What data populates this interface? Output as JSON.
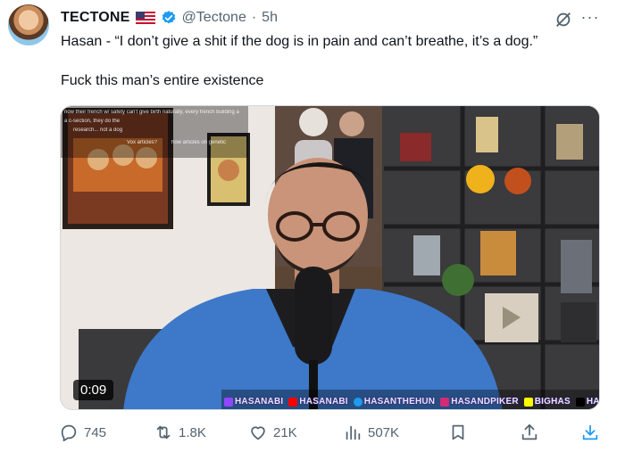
{
  "author": {
    "name": "TECTONE",
    "handle": "@Tectone",
    "separator": "·",
    "time": "5h"
  },
  "tweet": {
    "line1": "Hasan - “I don’t give a shit if the dog is in pain and can’t breathe, it’s a dog.”",
    "line2": "Fuck this man’s entire existence"
  },
  "video": {
    "timestamp": "0:09",
    "overlay_lines": [
      "now their french w/ safety can't give birth naturally, every french building a",
      "a c-section, they do the",
      "research... not a dog",
      "Vox articles?",
      "how articles on genetic"
    ],
    "socials": [
      {
        "icon": "twitch-icon",
        "label": "HASANABI",
        "color": "#9146ff"
      },
      {
        "icon": "youtube-icon",
        "label": "HASANABI",
        "color": "#ff0000"
      },
      {
        "icon": "twitter-icon",
        "label": "HASANTHEHUN",
        "color": "#1d9bf0"
      },
      {
        "icon": "instagram-icon",
        "label": "HASANDPIKER",
        "color": "#d62976"
      },
      {
        "icon": "snapchat-icon",
        "label": "BIGHAS",
        "color": "#fffc00"
      },
      {
        "icon": "tiktok-icon",
        "label": "HASANDPIKER",
        "color": "#000000"
      }
    ]
  },
  "actions": {
    "replies": "745",
    "reposts": "1.8K",
    "likes": "21K",
    "views": "507K"
  },
  "colors": {
    "muted": "#536471",
    "verified": "#1d9bf0",
    "text": "#0f1419"
  }
}
